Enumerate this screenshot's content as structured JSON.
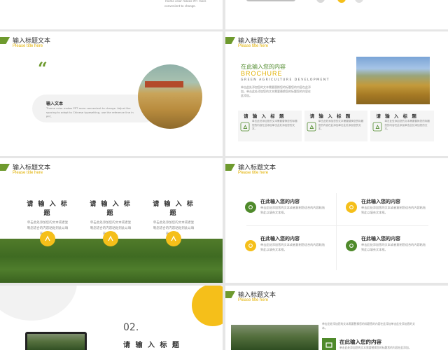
{
  "colors": {
    "green": "#4f8a2b",
    "yellow": "#f5bf1a",
    "gold_text": "#e1b000"
  },
  "top_left": {
    "text": "Theme color makes PPT more convenient to change."
  },
  "header": {
    "title": "输入标题文本",
    "subtitle": "Please title here"
  },
  "slide_quote": {
    "quote_mark": "“",
    "card_title": "输入文本",
    "card_body": "Theme color makes PPT more convenient to change. Adjust the spacing to adapt to Chinese typesetting, use the reference line in PPT."
  },
  "slide_brochure": {
    "heading": "在此输入您的内容",
    "brochure": "BROCHURE",
    "tagline": "GREEN AGRICULTURE DEVELOPMENT",
    "body": "单击此处添加您的文本需要替换您的标题您的内容在此添加。单击此处添加您的文本需要替换您的标题您的内容在此添加。",
    "cards": [
      {
        "title": "请 输 入 标 题",
        "body": "单击此处添加您的文本需要替换您的标题您的内容在此添加单击此处添加您的文本。"
      },
      {
        "title": "请 输 入 标 题",
        "body": "单击此处添加您的文本需要替换您的标题您的内容在此添加单击此处添加您的文本。"
      },
      {
        "title": "请 输 入 标 题",
        "body": "单击此处添加您的文本需要替换您的标题您的内容在此添加单击此处添加您的文本。"
      }
    ]
  },
  "slide_three": {
    "columns": [
      {
        "title": "请 输 入 标 题",
        "body": "单击此处添加您的文本或者复制您适合的内容粘贴到此以填充文本框。"
      },
      {
        "title": "请 输 入 标 题",
        "body": "单击此处添加您的文本或者复制您适合的内容粘贴到此以填充文本框。"
      },
      {
        "title": "请 输 入 标 题",
        "body": "单击此处添加您的文本或者复制您适合的内容粘贴到此以填充文本框。"
      }
    ]
  },
  "slide_grid": {
    "items": [
      {
        "title": "在此输入您的内容",
        "body": "单击此处添加您的文本或者复制您适合的内容粘贴到此以填充文本框。"
      },
      {
        "title": "在此输入您的内容",
        "body": "单击此处添加您的文本或者复制您适合的内容粘贴到此以填充文本框。"
      },
      {
        "title": "在此输入您的内容",
        "body": "单击此处添加您的文本或者复制您适合的内容粘贴到此以填充文本框。"
      },
      {
        "title": "在此输入您的内容",
        "body": "单击此处添加您的文本或者复制您适合的内容粘贴到此以填充文本框。"
      }
    ]
  },
  "slide_section": {
    "number": "02.",
    "title": "请 输 入 标 题"
  },
  "slide_last": {
    "body": "单击此处添加您的文本需要替换您的标题您的内容在此添加单击此处添加您的文本。",
    "heading": "在此输入您的内容",
    "body2": "单击此处添加您的文本需要替换您的标题您的内容在此添加。"
  }
}
